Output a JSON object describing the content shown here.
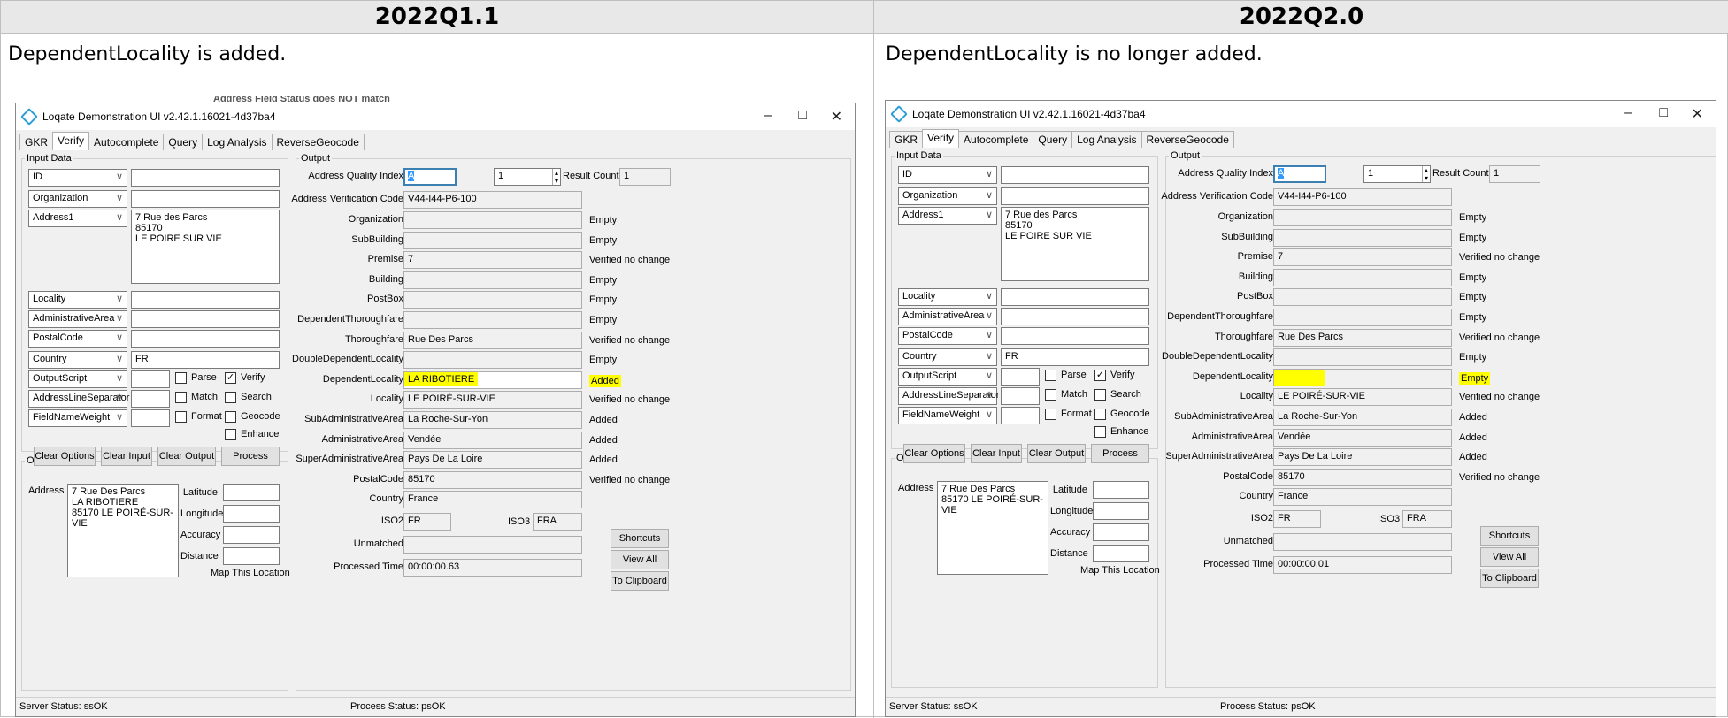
{
  "header": {
    "left": "2022Q1.1",
    "right": "2022Q2.0"
  },
  "descriptions": {
    "left": "DependentLocality is added.",
    "right": "DependentLocality is no longer added."
  },
  "behind_text": "Address Field Status does NOT match",
  "colors": {
    "highlight": "#ffff00",
    "accent": "#2a9fd6"
  },
  "window": {
    "title": "Loqate Demonstration UI v2.42.1.16021-4d37ba4",
    "tabs": [
      "GKR",
      "Verify",
      "Autocomplete",
      "Query",
      "Log Analysis",
      "ReverseGeocode"
    ],
    "input_data_label": "Input Data",
    "output_label": "Output",
    "combos": [
      "ID",
      "Organization",
      "Address1",
      "Locality",
      "AdministrativeArea",
      "PostalCode",
      "Country",
      "OutputScript",
      "AddressLineSeparator",
      "FieldNameWeight"
    ],
    "address1_value": "7 Rue des Parcs\n85170\nLE POIRE SUR VIE",
    "country_value": "FR",
    "checks": {
      "parse": "Parse",
      "verify": "Verify",
      "match": "Match",
      "search": "Search",
      "format": "Format",
      "geocode": "Geocode",
      "enhance": "Enhance"
    },
    "buttons": {
      "clear_options": "Clear Options",
      "clear_input": "Clear Input",
      "clear_output": "Clear Output",
      "process": "Process",
      "shortcuts": "Shortcuts",
      "view_all": "View All",
      "to_clipboard": "To Clipboard",
      "map": "Map This Location"
    },
    "output_address_label": "Address",
    "geo": {
      "latitude": "Latitude",
      "longitude": "Longitude",
      "accuracy": "Accuracy",
      "distance": "Distance"
    },
    "aqi_label": "Address Quality Index",
    "aqi_value": "A",
    "result_count_label": "Result Count",
    "spin_value": "1",
    "result_count": "1",
    "avc_label": "Address Verification Code",
    "avc_value": "V44-I44-P6-100",
    "field_labels": [
      "Organization",
      "SubBuilding",
      "Premise",
      "Building",
      "PostBox",
      "DependentThoroughfare",
      "Thoroughfare",
      "DoubleDependentLocality",
      "DependentLocality",
      "Locality",
      "SubAdministrativeArea",
      "AdministrativeArea",
      "SuperAdministrativeArea",
      "PostalCode",
      "Country"
    ],
    "iso2_label": "ISO2",
    "iso3_label": "ISO3",
    "iso2": "FR",
    "iso3": "FRA",
    "unmatched_label": "Unmatched",
    "processed_label": "Processed Time",
    "server_status": "Server Status: ssOK",
    "process_status": "Process Status: psOK"
  },
  "left": {
    "field_values": [
      "",
      "",
      "7",
      "",
      "",
      "",
      "Rue Des Parcs",
      "",
      "LA RIBOTIERE",
      "LE POIRÉ-SUR-VIE",
      "La Roche-Sur-Yon",
      "Vendée",
      "Pays De La Loire",
      "85170",
      "France"
    ],
    "field_status": [
      "Empty",
      "Empty",
      "Verified no change",
      "Empty",
      "Empty",
      "Empty",
      "Verified no change",
      "Empty",
      "Added",
      "Verified no change",
      "Added",
      "Added",
      "Added",
      "Verified no change",
      ""
    ],
    "output_address": "7 Rue Des Parcs\nLA RIBOTIERE\n85170 LE POIRÉ-SUR-VIE",
    "processed_time": "00:00:00.63"
  },
  "right": {
    "field_values": [
      "",
      "",
      "7",
      "",
      "",
      "",
      "Rue Des Parcs",
      "",
      "",
      "LE POIRÉ-SUR-VIE",
      "La Roche-Sur-Yon",
      "Vendée",
      "Pays De La Loire",
      "85170",
      "France"
    ],
    "field_status": [
      "Empty",
      "Empty",
      "Verified no change",
      "Empty",
      "Empty",
      "Empty",
      "Verified no change",
      "Empty",
      "Empty",
      "Verified no change",
      "Added",
      "Added",
      "Added",
      "Verified no change",
      ""
    ],
    "output_address": "7 Rue Des Parcs\n85170 LE POIRÉ-SUR-VIE",
    "processed_time": "00:00:00.01"
  }
}
